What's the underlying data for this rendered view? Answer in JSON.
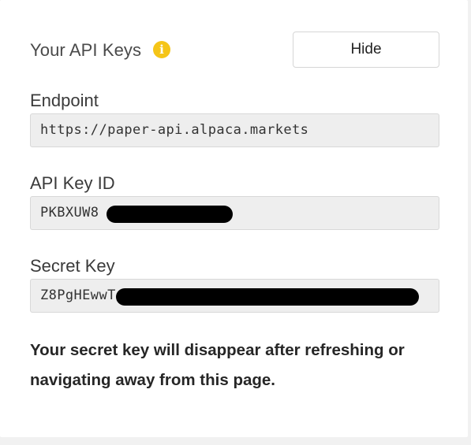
{
  "header": {
    "title": "Your API Keys",
    "info_icon": "info-icon",
    "hide_label": "Hide"
  },
  "endpoint": {
    "label": "Endpoint",
    "value": "https://paper-api.alpaca.markets"
  },
  "api_key_id": {
    "label": "API Key ID",
    "value_visible": "PKBXUW8"
  },
  "secret_key": {
    "label": "Secret Key",
    "value_visible": "Z8PgHEwwT"
  },
  "notice": "Your secret key will disappear after refreshing or navigating away from this page.",
  "colors": {
    "info_icon": "#f5c518",
    "field_background": "#eeeeee",
    "redaction": "#000000"
  }
}
